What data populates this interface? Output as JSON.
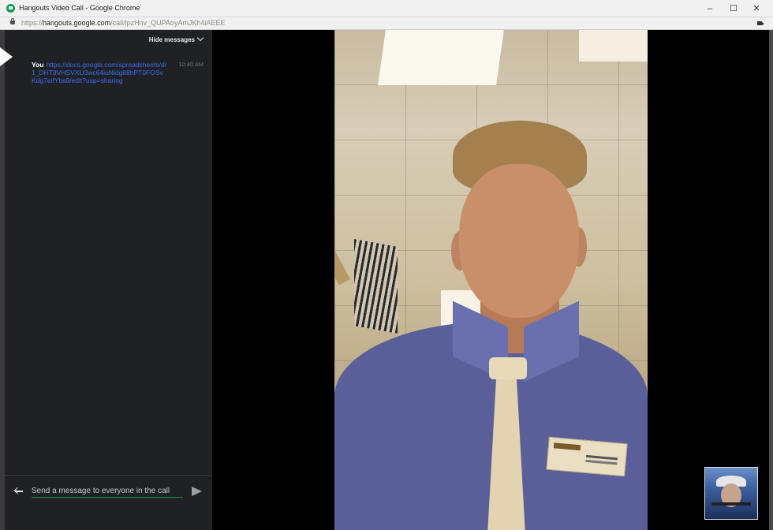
{
  "window": {
    "title": "Hangouts Video Call - Google Chrome",
    "minimize": "–",
    "maximize": "☐",
    "close": "✕"
  },
  "address": {
    "scheme": "https://",
    "host": "hangouts.google.com",
    "path": "/call/lpzHnv_QUPAoyAmJKh4iAEEE"
  },
  "chat": {
    "hide_label": "Hide messages",
    "messages": [
      {
        "sender": "You",
        "text": "https://docs.google.com/spreadsheets/d/1_DHT9VHSVXU3wc64iuNldg88hPT0FGSvKdg7eifYbs8/edit?usp=sharing",
        "time": "10:40 AM"
      }
    ],
    "input_placeholder": "Send a message to everyone in the call"
  },
  "icons": {
    "favicon": "hangouts-icon",
    "lock": "lock-icon",
    "camera": "camera-icon",
    "back": "arrow-left-icon",
    "send": "send-icon",
    "hide_chevron": "chevron-down-icon"
  },
  "colors": {
    "panel_bg": "#202124",
    "input_underline": "#1e8e3e",
    "link": "#3b6df0"
  }
}
